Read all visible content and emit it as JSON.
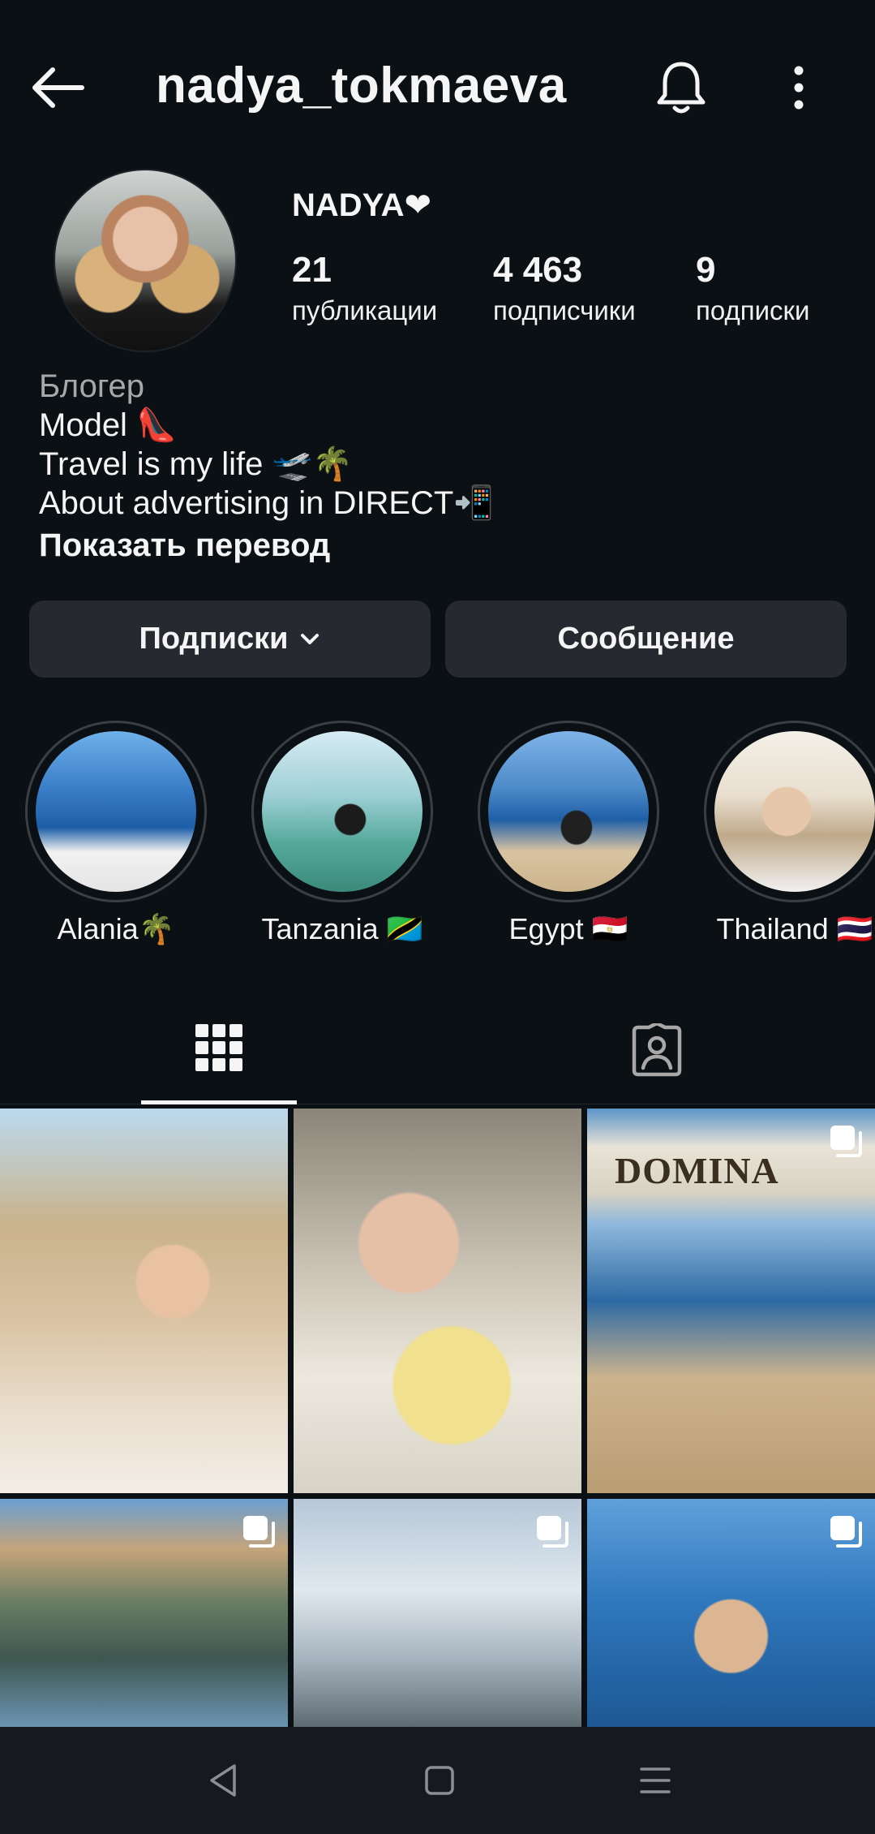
{
  "header": {
    "username": "nadya_tokmaeva",
    "back_icon": "arrow-left-icon",
    "bell_icon": "bell-icon",
    "more_icon": "more-vertical-icon"
  },
  "profile": {
    "display_name": "NADYA❤",
    "stats": [
      {
        "value": "21",
        "label": "публикации"
      },
      {
        "value": "4 463",
        "label": "подписчики"
      },
      {
        "value": "9",
        "label": "подписки"
      }
    ],
    "bio": {
      "category": "Блогер",
      "lines": [
        "Model 👠",
        "Travel is my life 🛫🌴",
        "About advertising in DIRECT📲"
      ],
      "translate": "Показать перевод"
    }
  },
  "actions": {
    "following": "Подписки",
    "message": "Сообщение"
  },
  "highlights": [
    {
      "name": "Alania🌴"
    },
    {
      "name": "Tanzania 🇹🇿"
    },
    {
      "name": "Egypt 🇪🇬"
    },
    {
      "name": "Thailand 🇹🇭"
    }
  ],
  "tabs": {
    "active": "grid",
    "items": [
      "grid-icon",
      "tagged-icon"
    ]
  },
  "posts": {
    "domina_text": "DOMINA"
  },
  "colors": {
    "background": "#0b1014",
    "button": "#262a30",
    "text": "#f5f5f5",
    "muted": "#a8a8a8"
  }
}
